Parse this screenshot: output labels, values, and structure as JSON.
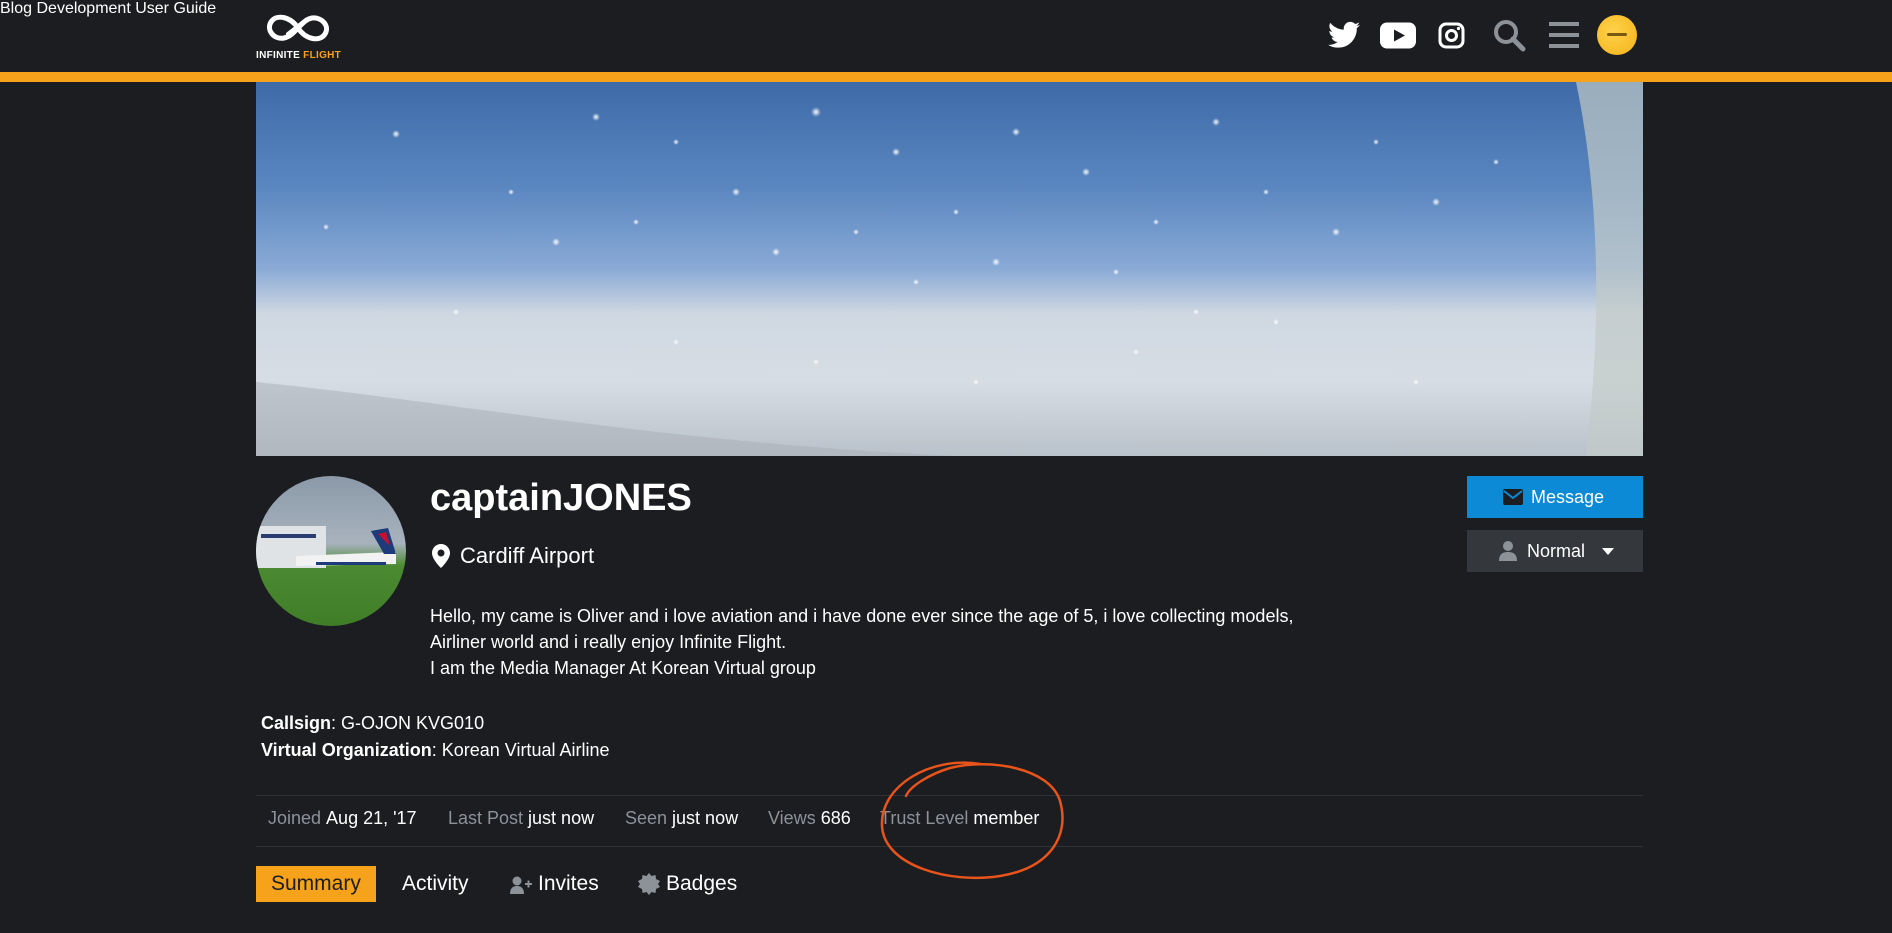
{
  "header": {
    "logo": {
      "word1": "INFINITE",
      "word2": "FLIGHT"
    },
    "nav": [
      "Blog",
      "Development",
      "User Guide"
    ],
    "icons": [
      "twitter-icon",
      "youtube-icon",
      "instagram-icon",
      "search-icon",
      "hamburger-menu-icon",
      "user-avatar"
    ],
    "accent": "#f6a21a"
  },
  "profile": {
    "username": "captainJONES",
    "location": "Cardiff Airport",
    "bio": [
      "Hello, my came is Oliver and i love aviation and i have done ever since the age of 5, i love collecting models,",
      "Airliner world and i really enjoy Infinite Flight.",
      "I am the Media Manager At Korean Virtual group"
    ],
    "fields": {
      "callsign_label": "Callsign",
      "callsign_value": "G-OJON KVG010",
      "vo_label": "Virtual Organization",
      "vo_value": "Korean Virtual Airline"
    }
  },
  "buttons": {
    "message": "Message",
    "notification_level": "Normal",
    "message_color": "#0d8ad6"
  },
  "stats": {
    "joined_label": "Joined",
    "joined_value": "Aug 21, '17",
    "lastpost_label": "Last Post",
    "lastpost_value": "just now",
    "seen_label": "Seen",
    "seen_value": "just now",
    "views_label": "Views",
    "views_value": "686",
    "trust_label": "Trust Level",
    "trust_value": "member"
  },
  "tabs": [
    "Summary",
    "Activity",
    "Invites",
    "Badges"
  ],
  "annotation": {
    "type": "hand-drawn-circle",
    "color": "#e8541a"
  }
}
